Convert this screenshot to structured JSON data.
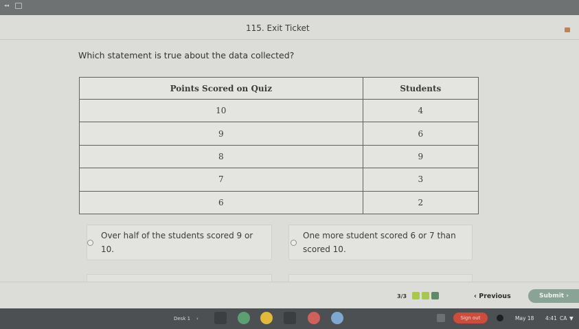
{
  "header": {
    "title": "115. Exit Ticket"
  },
  "question": "Which statement is true about the data collected?",
  "table": {
    "headers": [
      "Points Scored on Quiz",
      "Students"
    ],
    "rows": [
      [
        "10",
        "4"
      ],
      [
        "9",
        "6"
      ],
      [
        "8",
        "9"
      ],
      [
        "7",
        "3"
      ],
      [
        "6",
        "2"
      ]
    ]
  },
  "choices": [
    {
      "line1": "Over half of the students scored 9 or",
      "line2": "10."
    },
    {
      "line1": "One more student scored 6 or 7 than",
      "line2": "scored 10."
    }
  ],
  "footer": {
    "page_count": "3/3",
    "previous_label": "Previous",
    "submit_label": "Submit",
    "dot_colors": [
      "#a8c84a",
      "#a8c84a",
      "#5e8a6a"
    ]
  },
  "shelf": {
    "desk_label": "Desk 1",
    "sign_out_label": "Sign out",
    "date": "May 18",
    "time": "4:41",
    "region": "CA"
  },
  "colors": {
    "submit": "#8aa399",
    "sign_out": "#d04b3c",
    "taskbar": "#4d5052"
  }
}
